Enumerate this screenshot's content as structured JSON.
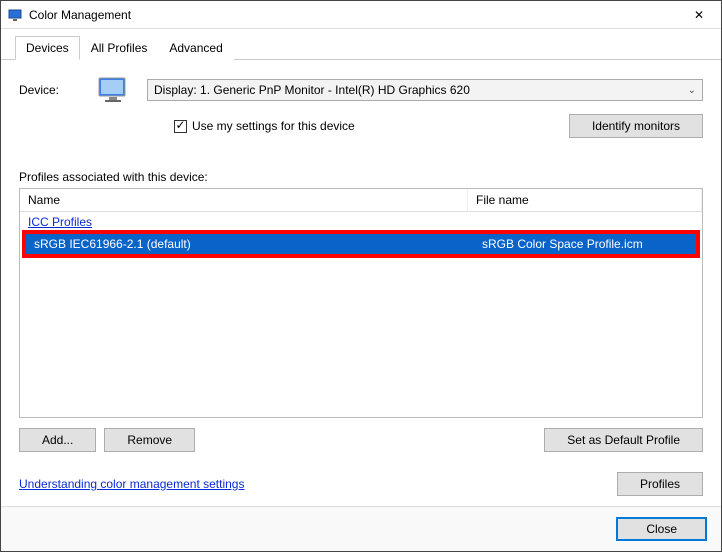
{
  "window": {
    "title": "Color Management"
  },
  "tabs": {
    "devices": "Devices",
    "all_profiles": "All Profiles",
    "advanced": "Advanced"
  },
  "device": {
    "label": "Device:",
    "selected": "Display: 1. Generic PnP Monitor - Intel(R) HD Graphics 620",
    "use_settings_label": "Use my settings for this device",
    "use_settings_checked": true,
    "identify_label": "Identify monitors"
  },
  "profiles": {
    "section_label": "Profiles associated with this device:",
    "columns": {
      "name": "Name",
      "file_name": "File name"
    },
    "group_header": "ICC Profiles",
    "rows": [
      {
        "name": "sRGB IEC61966-2.1 (default)",
        "file_name": "sRGB Color Space Profile.icm",
        "selected": true
      }
    ]
  },
  "buttons": {
    "add": "Add...",
    "remove": "Remove",
    "set_default": "Set as Default Profile",
    "profiles": "Profiles",
    "close": "Close"
  },
  "link": {
    "understanding": "Understanding color management settings"
  }
}
